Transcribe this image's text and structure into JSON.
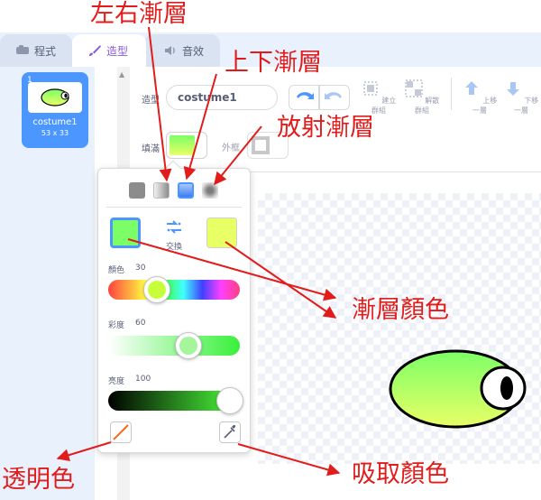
{
  "tabs": [
    {
      "label": "程式",
      "icon": "code-icon"
    },
    {
      "label": "造型",
      "icon": "brush-icon"
    },
    {
      "label": "音效",
      "icon": "sound-icon"
    }
  ],
  "costume_list": {
    "items": [
      {
        "index": "1",
        "name": "costume1",
        "size": "53 x 33"
      }
    ]
  },
  "editor": {
    "costume_label": "造型",
    "costume_name": "costume1",
    "group_label": "建立群組",
    "ungroup_label": "解散群組",
    "forward_label": "上移一層",
    "backward_label": "下移一層",
    "fill_label": "填滿",
    "outline_label": "外框"
  },
  "color_picker": {
    "swap_label": "交換",
    "hue_label": "顏色",
    "hue_value": "30",
    "saturation_label": "彩度",
    "saturation_value": "60",
    "brightness_label": "亮度",
    "brightness_value": "100",
    "hue_level": 0.3,
    "saturation_level": 0.6,
    "brightness_level": 1.0
  },
  "annotations": {
    "left_right_gradient": "左右漸層",
    "top_bottom_gradient": "上下漸層",
    "radial_gradient": "放射漸層",
    "gradient_colors": "漸層顏色",
    "transparent": "透明色",
    "eyedropper": "吸取顏色"
  },
  "colors": {
    "accent_blue": "#4c97ff",
    "annotation_red": "#e21b1b",
    "gradient_start": "#7cff66",
    "gradient_end": "#e9ff66"
  }
}
